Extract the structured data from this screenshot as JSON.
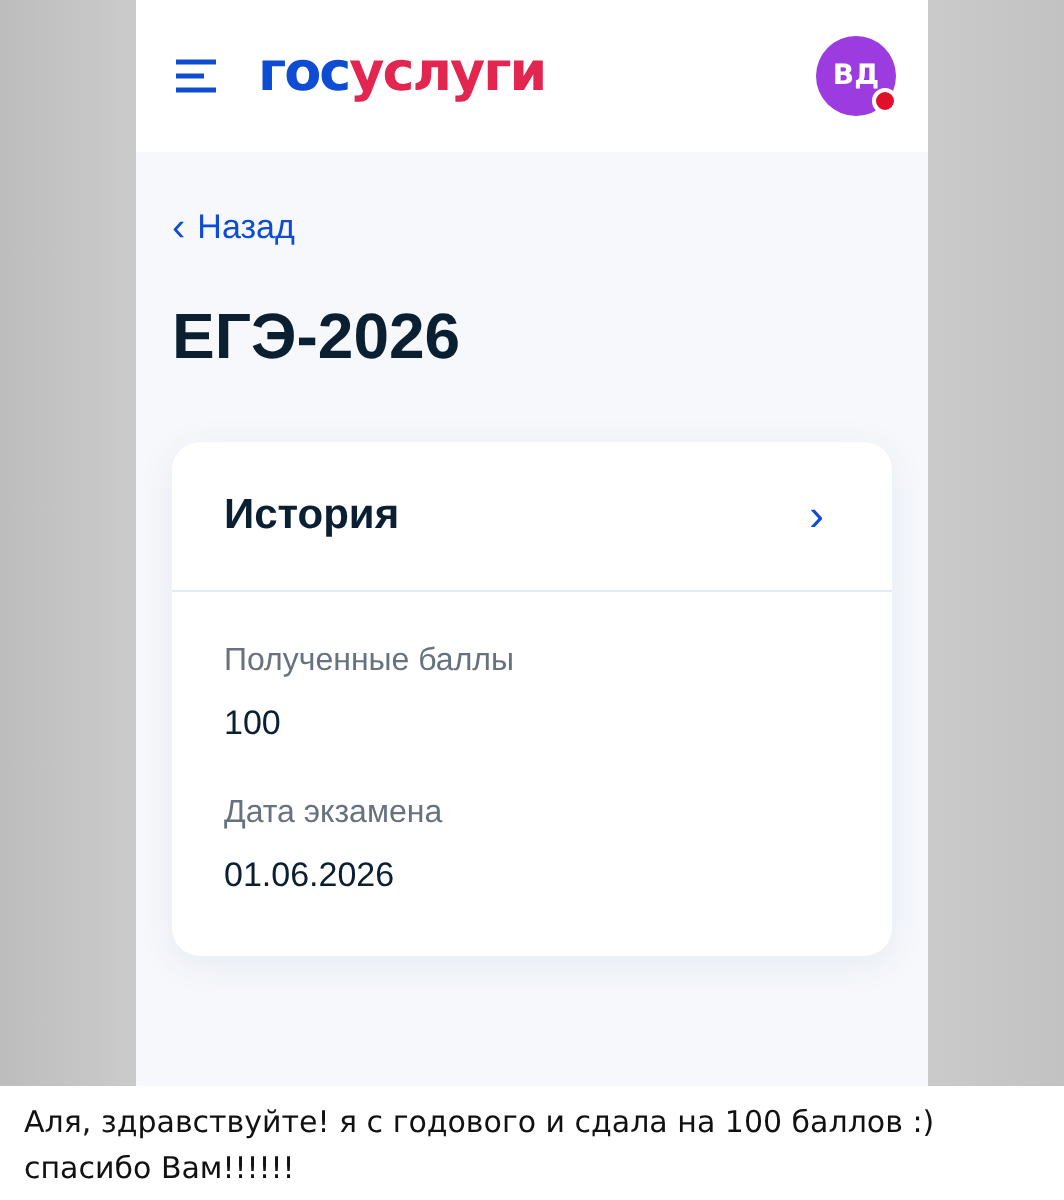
{
  "header": {
    "logo": [
      {
        "text": "гос",
        "color": "#0d4cd3"
      },
      {
        "text": "услуги",
        "color": "#e3264f"
      }
    ],
    "avatar": {
      "initials": "ВД",
      "notification": true
    }
  },
  "back_link": {
    "icon": "‹",
    "label": "Назад"
  },
  "title": "ЕГЭ-2026",
  "card": {
    "subject": "История",
    "chevron": "›",
    "fields": [
      {
        "label": "Полученные баллы",
        "value": "100"
      },
      {
        "label": "Дата экзамена",
        "value": "01.06.2026"
      }
    ]
  },
  "caption": "Аля, здравствуйте! я с годового и сдала на 100 баллов :) спасибо Вам!!!!!!"
}
